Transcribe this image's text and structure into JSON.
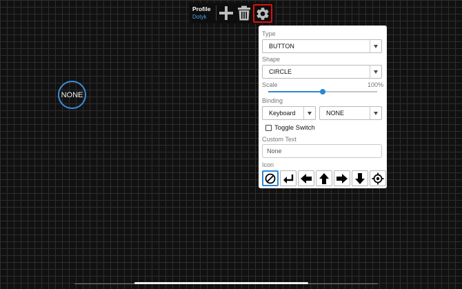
{
  "toolbar": {
    "profile_label": "Profile",
    "profile_name": "Dotyk",
    "icons": [
      "plus-icon",
      "trash-icon",
      "gear-icon"
    ]
  },
  "canvas": {
    "button_label": "NONE"
  },
  "panel": {
    "type_label": "Type",
    "type_value": "BUTTON",
    "shape_label": "Shape",
    "shape_value": "CIRCLE",
    "scale_label": "Scale",
    "scale_value_text": "100%",
    "scale_fraction": 0.5,
    "binding_label": "Binding",
    "binding_source": "Keyboard",
    "binding_key": "NONE",
    "toggle_label": "Toggle Switch",
    "toggle_checked": false,
    "custom_text_label": "Custom Text",
    "custom_text_placeholder": "None",
    "icon_label": "Icon",
    "icons": [
      "none-icon",
      "enter-icon",
      "arrow-left-icon",
      "arrow-up-icon",
      "arrow-right-icon",
      "arrow-down-icon",
      "crosshair-icon"
    ],
    "selected_icon": "none-icon"
  },
  "colors": {
    "accent": "#2a87d6",
    "highlight": "#e01010",
    "background": "#111111"
  }
}
